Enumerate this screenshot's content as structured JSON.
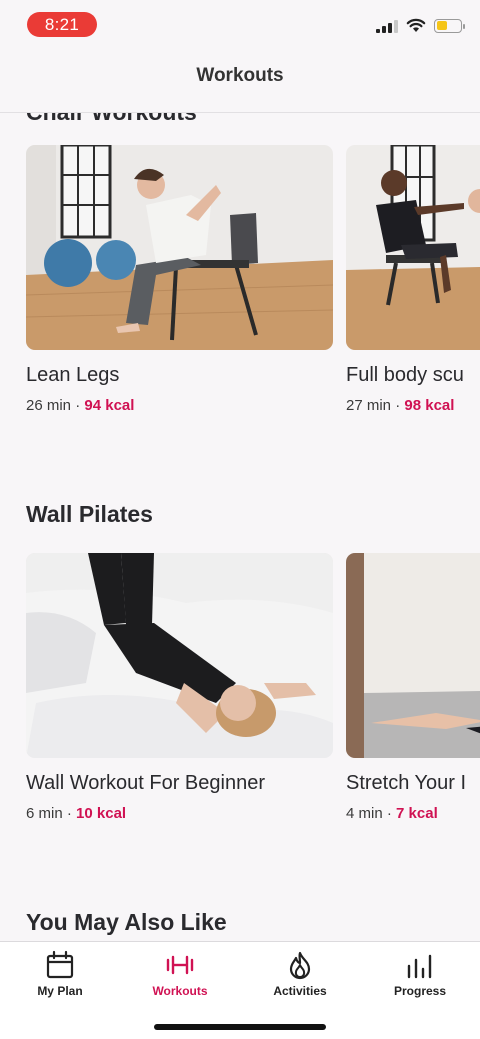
{
  "status_bar": {
    "time": "8:21",
    "battery_level": 0.45,
    "accent": "#ea3b36"
  },
  "header": {
    "title": "Workouts"
  },
  "sections": [
    {
      "title": "Chair Workouts",
      "cards": [
        {
          "title": "Lean Legs",
          "duration": "26 min",
          "separator": "·",
          "kcal": "94 kcal"
        },
        {
          "title": "Full body scu",
          "duration": "27 min",
          "separator": "·",
          "kcal": "98 kcal"
        }
      ]
    },
    {
      "title": "Wall Pilates",
      "cards": [
        {
          "title": "Wall Workout For Beginner",
          "duration": "6 min",
          "separator": "·",
          "kcal": "10 kcal"
        },
        {
          "title": "Stretch Your I",
          "duration": "4 min",
          "separator": "·",
          "kcal": "7 kcal"
        }
      ]
    },
    {
      "title": "You May Also Like"
    }
  ],
  "tabs": [
    {
      "label": "My Plan",
      "icon": "calendar-icon",
      "active": false
    },
    {
      "label": "Workouts",
      "icon": "dumbbell-icon",
      "active": true
    },
    {
      "label": "Activities",
      "icon": "flame-icon",
      "active": false
    },
    {
      "label": "Progress",
      "icon": "bar-chart-icon",
      "active": false
    }
  ],
  "colors": {
    "accent": "#d01253",
    "background": "#f8f6f8"
  }
}
